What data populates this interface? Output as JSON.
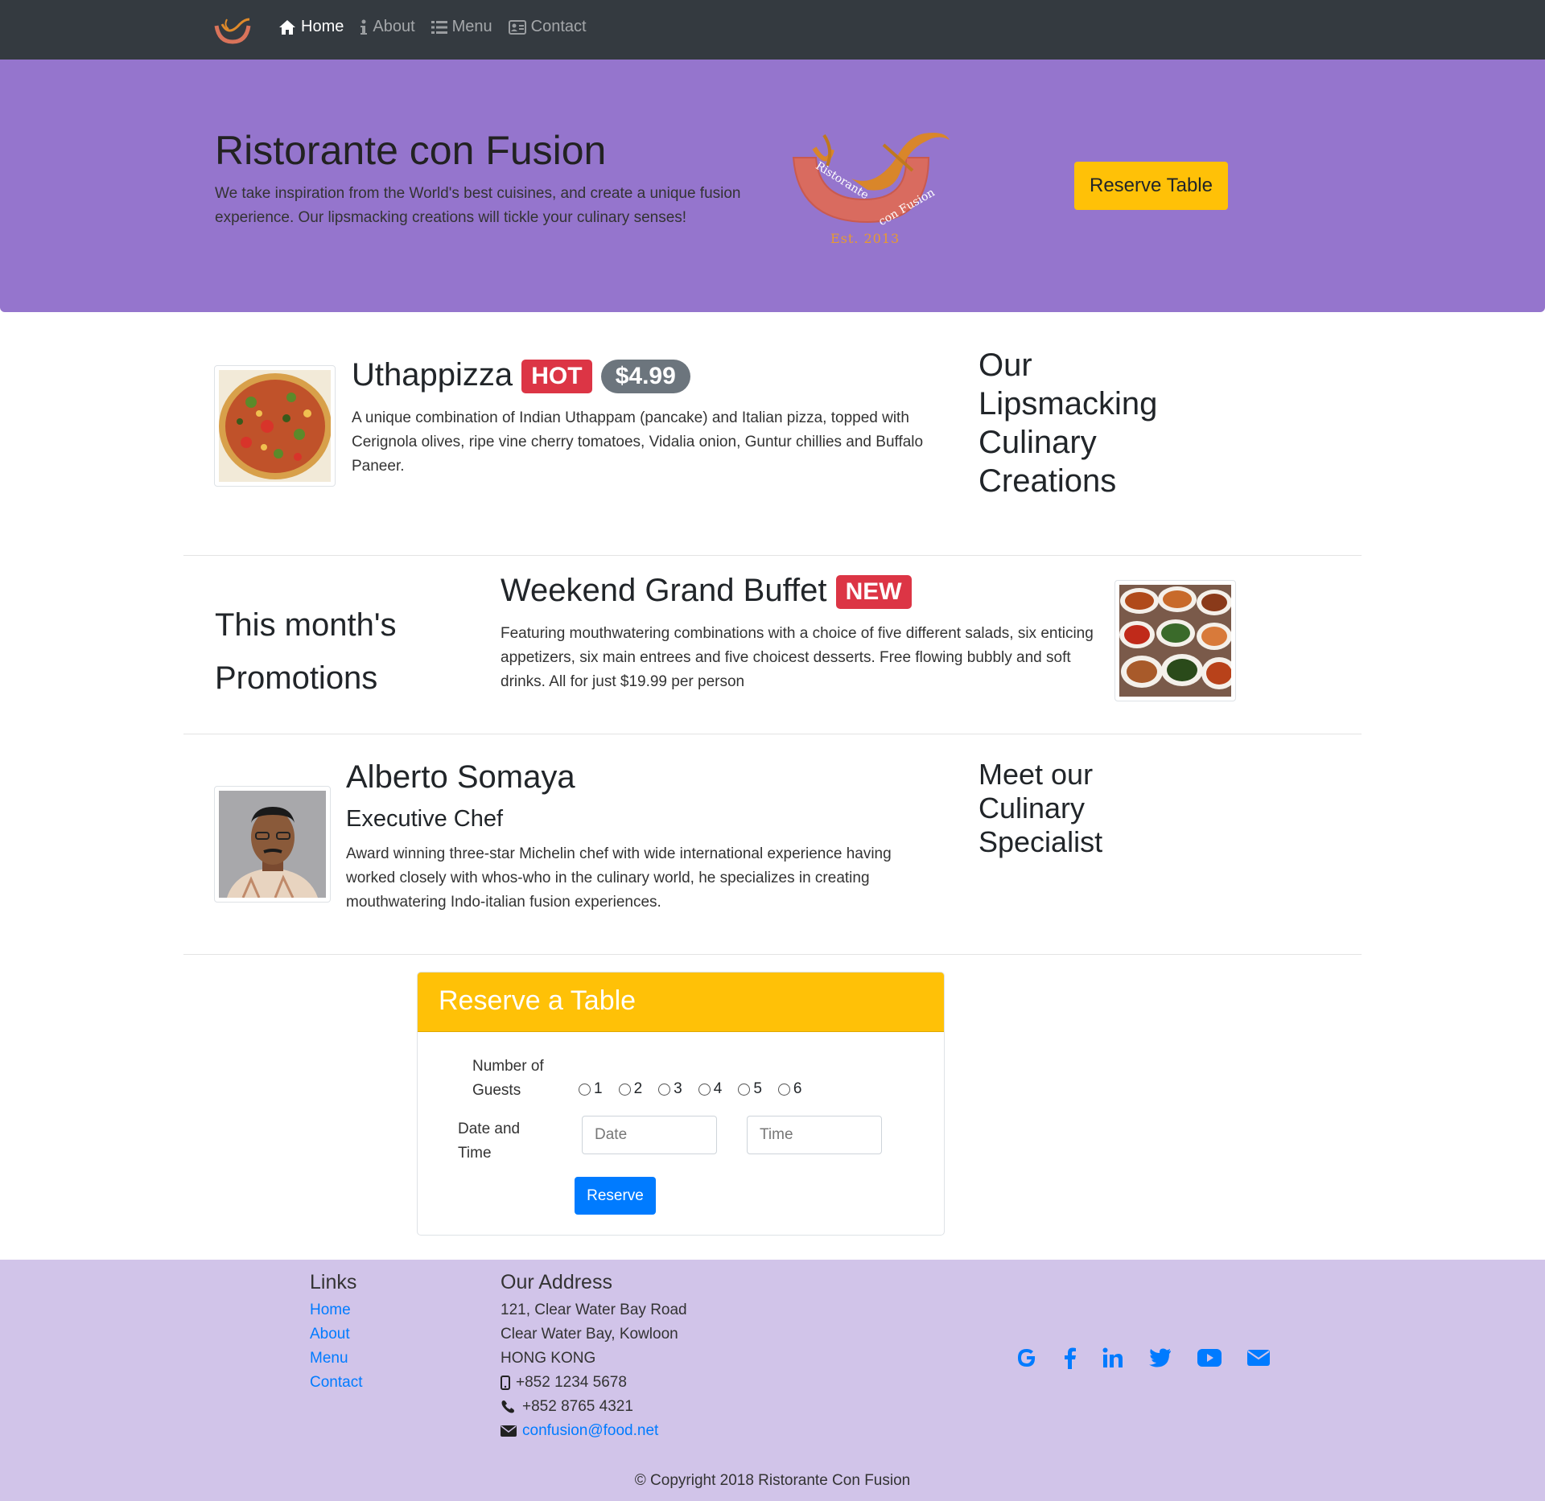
{
  "nav": {
    "items": [
      {
        "label": "Home",
        "icon": "home-icon",
        "active": true
      },
      {
        "label": "About",
        "icon": "info-icon",
        "active": false
      },
      {
        "label": "Menu",
        "icon": "list-icon",
        "active": false
      },
      {
        "label": "Contact",
        "icon": "address-card-icon",
        "active": false
      }
    ]
  },
  "jumbotron": {
    "title": "Ristorante con Fusion",
    "text": "We take inspiration from the World's best cuisines, and create a unique fusion experience. Our lipsmacking creations will tickle your culinary senses!",
    "logo_text": "Ristorante con Fusion",
    "logo_est": "Est. 2013",
    "reserve_label": "Reserve Table"
  },
  "dish": {
    "name": "Uthappizza",
    "badge": "HOT",
    "price": "$4.99",
    "description": "A unique combination of Indian Uthappam (pancake) and Italian pizza, topped with Cerignola olives, ripe vine cherry tomatoes, Vidalia onion, Guntur chillies and Buffalo Paneer.",
    "side_heading": "Our Lipsmacking Culinary Creations"
  },
  "promotion": {
    "side_heading": "This month's Promotions",
    "name": "Weekend Grand Buffet",
    "badge": "NEW",
    "description": "Featuring mouthwatering combinations with a choice of five different salads, six enticing appetizers, six main entrees and five choicest desserts. Free flowing bubbly and soft drinks. All for just $19.99 per person"
  },
  "chef": {
    "name": "Alberto Somaya",
    "title": "Executive Chef",
    "description": "Award winning three-star Michelin chef with wide international experience having worked closely with whos-who in the culinary world, he specializes in creating mouthwatering Indo-italian fusion experiences.",
    "side_heading": "Meet our Culinary Specialist"
  },
  "reserve": {
    "title": "Reserve a Table",
    "guests_label": "Number of Guests",
    "guest_options": [
      "1",
      "2",
      "3",
      "4",
      "5",
      "6"
    ],
    "datetime_label": "Date and Time",
    "date_placeholder": "Date",
    "time_placeholder": "Time",
    "submit_label": "Reserve"
  },
  "footer": {
    "links_heading": "Links",
    "links": [
      "Home",
      "About",
      "Menu",
      "Contact"
    ],
    "address_heading": "Our Address",
    "address_lines": [
      "121, Clear Water Bay Road",
      "Clear Water Bay, Kowloon",
      "HONG KONG"
    ],
    "phone": "+852 1234 5678",
    "fax": "+852 8765 4321",
    "email": "confusion@food.net",
    "socials": [
      "google-icon",
      "facebook-icon",
      "linkedin-icon",
      "twitter-icon",
      "youtube-icon",
      "envelope-icon"
    ],
    "copyright": "© Copyright 2018 Ristorante Con Fusion"
  },
  "colors": {
    "navbar": "#343a40",
    "jumbotron": "#9575cd",
    "footer": "#d1c4e9",
    "warning": "#ffc107",
    "primary": "#007bff",
    "danger": "#dc3545"
  }
}
